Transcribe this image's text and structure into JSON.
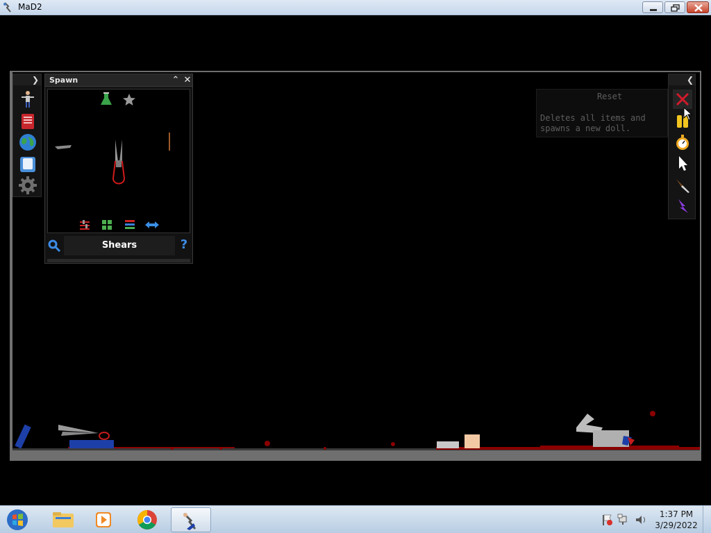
{
  "window": {
    "title": "MaD2"
  },
  "spawn_panel": {
    "title": "Spawn",
    "selected_item": "Shears",
    "filter_icons": [
      "flask-icon",
      "star-icon"
    ],
    "view_icons": [
      "sliders-icon",
      "grid-icon",
      "list-icon",
      "swap-arrows-icon"
    ]
  },
  "left_toolbar": {
    "items": [
      "ragdoll-icon",
      "book-icon",
      "globe-icon",
      "save-icon",
      "gear-icon"
    ]
  },
  "right_toolbar": {
    "items": [
      "reset-x-icon",
      "pause-icon",
      "stopwatch-icon",
      "cursor-icon",
      "knife-icon",
      "lightning-icon"
    ]
  },
  "tooltip": {
    "title": "Reset",
    "body": "Deletes all items and spawns a new doll."
  },
  "taskbar": {
    "pinned": [
      "windows-start-icon",
      "explorer-icon",
      "media-player-icon",
      "chrome-icon",
      "mad2-app-icon"
    ],
    "time": "1:37 PM",
    "date": "3/29/2022"
  },
  "colors": {
    "accent_red": "#cc1f2b",
    "blood": "#8b0000",
    "help_blue": "#3c8be6",
    "frame_gray": "#6f6f6f"
  }
}
